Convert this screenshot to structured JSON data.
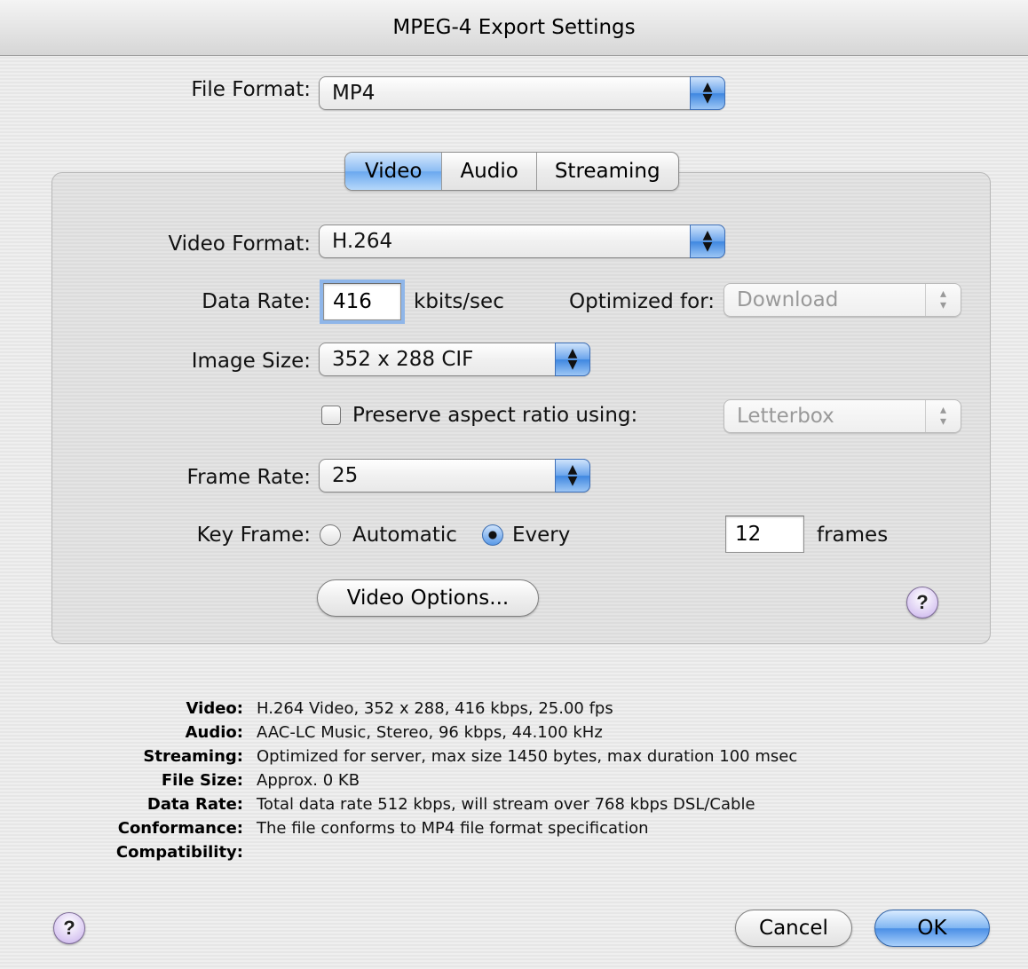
{
  "window": {
    "title": "MPEG-4 Export Settings"
  },
  "file_format": {
    "label": "File Format:",
    "value": "MP4"
  },
  "tabs": [
    {
      "label": "Video",
      "active": true
    },
    {
      "label": "Audio",
      "active": false
    },
    {
      "label": "Streaming",
      "active": false
    }
  ],
  "video": {
    "video_format": {
      "label": "Video Format:",
      "value": "H.264"
    },
    "data_rate": {
      "label": "Data Rate:",
      "value": "416",
      "unit": "kbits/sec"
    },
    "optimized_for": {
      "label": "Optimized for:",
      "value": "Download",
      "enabled": false
    },
    "image_size": {
      "label": "Image Size:",
      "value": "352 x 288 CIF"
    },
    "preserve_aspect": {
      "label": "Preserve aspect ratio using:",
      "checked": false,
      "value": "Letterbox",
      "enabled": false
    },
    "frame_rate": {
      "label": "Frame Rate:",
      "value": "25"
    },
    "key_frame": {
      "label": "Key Frame:",
      "option_automatic": "Automatic",
      "option_every": "Every",
      "selected": "Every",
      "frames_value": "12",
      "frames_unit": "frames"
    },
    "video_options_button": "Video Options..."
  },
  "summary": [
    {
      "key": "Video:",
      "value": "H.264 Video, 352 x 288, 416 kbps, 25.00 fps"
    },
    {
      "key": "Audio:",
      "value": "AAC-LC Music, Stereo, 96 kbps, 44.100 kHz"
    },
    {
      "key": "Streaming:",
      "value": "Optimized for server, max size 1450 bytes, max duration 100 msec"
    },
    {
      "key": "File Size:",
      "value": "Approx. 0 KB"
    },
    {
      "key": "Data Rate:",
      "value": "Total data rate 512 kbps, will stream over 768 kbps DSL/Cable"
    },
    {
      "key": "Conformance:",
      "value": "The file conforms to MP4 file format specification"
    },
    {
      "key": "Compatibility:",
      "value": ""
    }
  ],
  "buttons": {
    "cancel": "Cancel",
    "ok": "OK",
    "help_glyph": "?"
  },
  "icons": {
    "popup_arrows": "▲▼",
    "stepper_arrows": "▴▾"
  }
}
